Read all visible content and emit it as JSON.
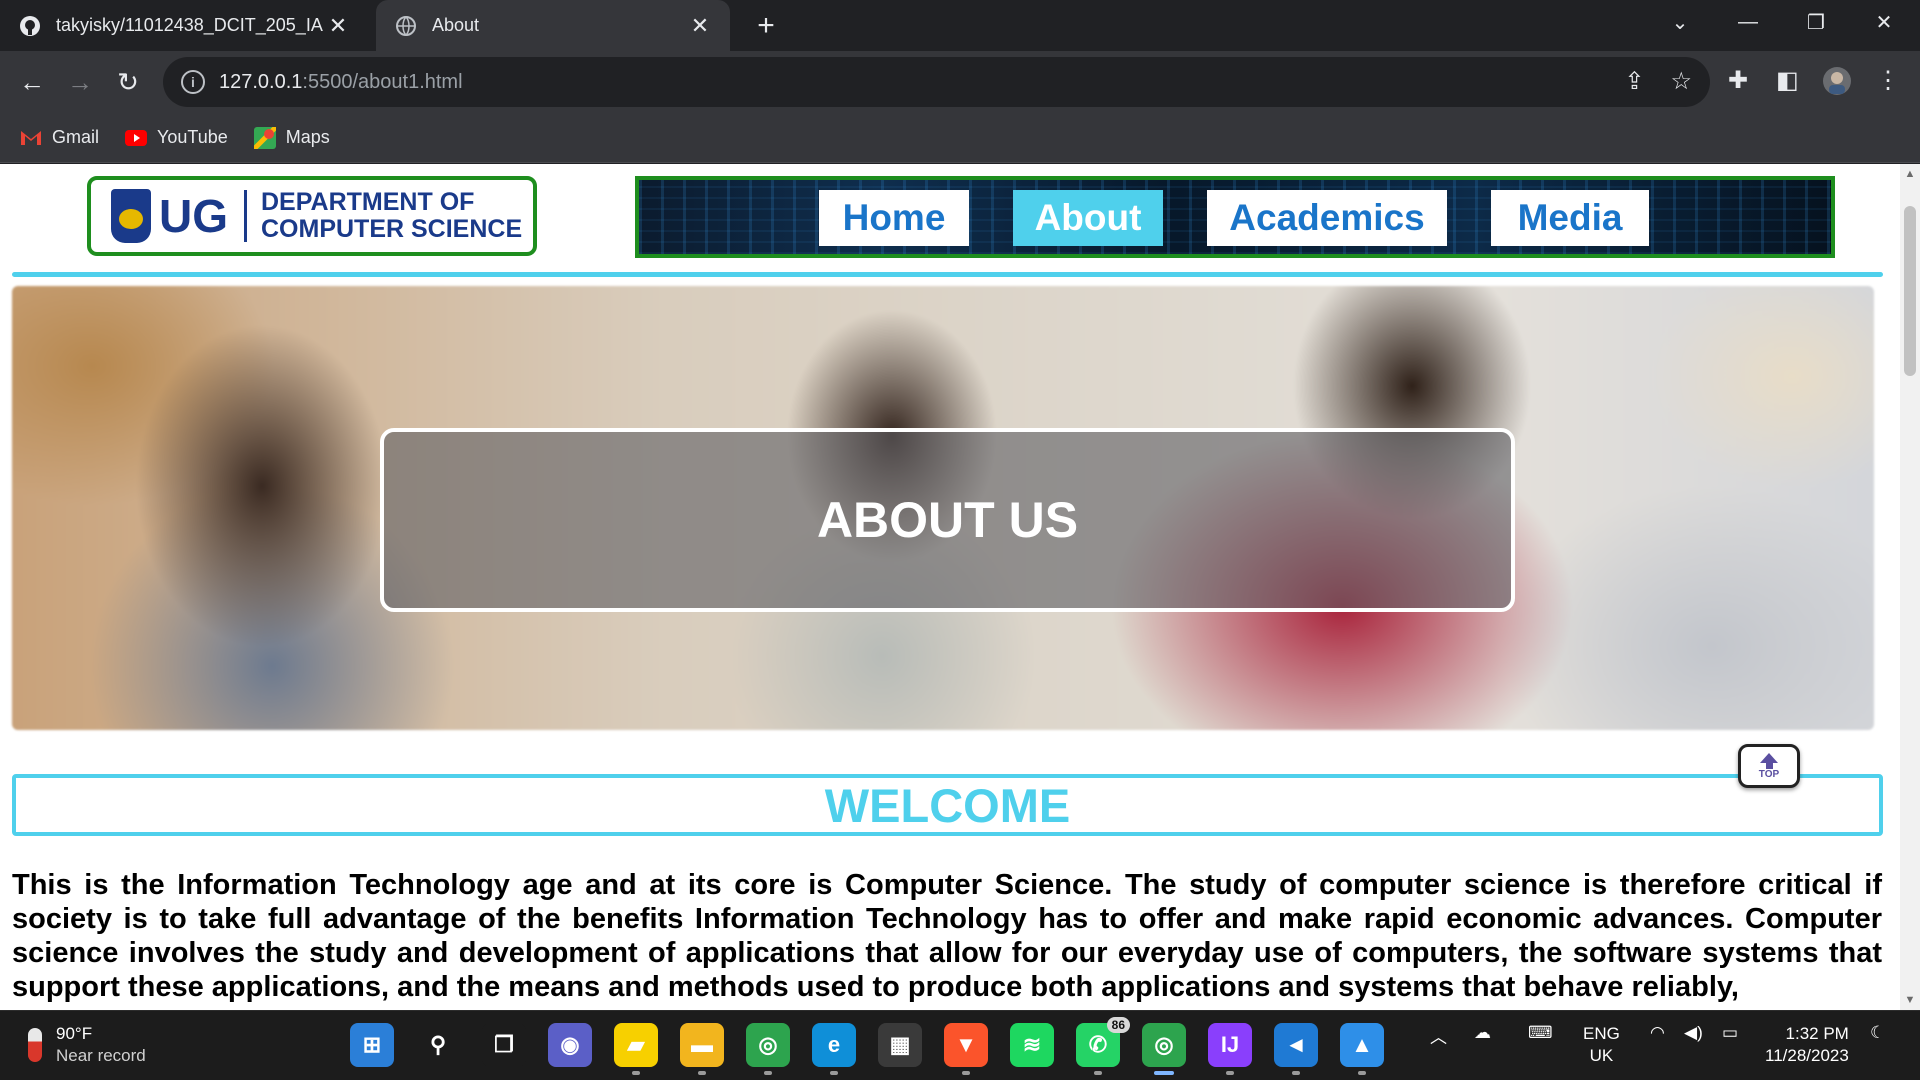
{
  "browser": {
    "tabs": [
      {
        "title": "takyisky/11012438_DCIT_205_IA",
        "icon": "github-icon",
        "active": false
      },
      {
        "title": "About",
        "icon": "globe-icon",
        "active": true
      }
    ],
    "new_tab_label": "+",
    "address": {
      "host": "127.0.0.1",
      "rest": ":5500/about1.html"
    },
    "bookmarks": [
      {
        "label": "Gmail",
        "icon": "gmail-icon",
        "color": "#ea4335"
      },
      {
        "label": "YouTube",
        "icon": "youtube-icon",
        "color": "#ff0000"
      },
      {
        "label": "Maps",
        "icon": "maps-icon",
        "color": "#34a853"
      }
    ]
  },
  "site": {
    "logo": {
      "ug": "UG",
      "dept_line1": "DEPARTMENT OF",
      "dept_line2": "COMPUTER SCIENCE"
    },
    "nav": [
      {
        "label": "Home",
        "active": false
      },
      {
        "label": "About",
        "active": true
      },
      {
        "label": "Academics",
        "active": false
      },
      {
        "label": "Media",
        "active": false
      }
    ],
    "hero_title": "ABOUT US",
    "top_button": "TOP",
    "welcome": "WELCOME",
    "intro": "This is the Information Technology age and at its core is Computer Science. The study of computer science is therefore critical if society is to take full advantage of the benefits Information Technology has to offer and make rapid economic advances. Computer science involves the study and development of applications that allow for our everyday use of computers, the software systems that support these applications, and the means and methods used to produce both applications and systems that behave reliably,",
    "colors": {
      "accent": "#4fd0ec",
      "brand": "#1a3a8a",
      "border_green": "#1e8e1e",
      "nav_text": "#1a75c9"
    }
  },
  "taskbar": {
    "weather": {
      "temp": "90°F",
      "condition": "Near record"
    },
    "apps": [
      {
        "name": "windows-start-icon",
        "glyph": "⊞",
        "color": "#2b7fd8"
      },
      {
        "name": "search-icon",
        "glyph": "⚲",
        "color": "#1c1c1c"
      },
      {
        "name": "task-view-icon",
        "glyph": "❐",
        "color": "#1c1c1c"
      },
      {
        "name": "teams-chat-icon",
        "glyph": "◉",
        "color": "#5b5fc7"
      },
      {
        "name": "sticky-notes-icon",
        "glyph": "▰",
        "color": "#f7d000"
      },
      {
        "name": "file-explorer-icon",
        "glyph": "▬",
        "color": "#f2b51e"
      },
      {
        "name": "chrome-icon",
        "glyph": "◎",
        "color": "#2da44e"
      },
      {
        "name": "edge-icon",
        "glyph": "e",
        "color": "#0f8fd8"
      },
      {
        "name": "microsoft-store-icon",
        "glyph": "▦",
        "color": "#3a3a3a"
      },
      {
        "name": "brave-icon",
        "glyph": "▼",
        "color": "#fb542b"
      },
      {
        "name": "spotify-icon",
        "glyph": "≋",
        "color": "#1ed760"
      },
      {
        "name": "whatsapp-icon",
        "glyph": "✆",
        "color": "#25d366",
        "badge": "86"
      },
      {
        "name": "chrome-profile-icon",
        "glyph": "◎",
        "color": "#2da44e"
      },
      {
        "name": "intellij-icon",
        "glyph": "IJ",
        "color": "#8a3ffc"
      },
      {
        "name": "vscode-icon",
        "glyph": "◄",
        "color": "#1f7ad4"
      },
      {
        "name": "photos-icon",
        "glyph": "▲",
        "color": "#2e8fe8"
      }
    ],
    "lang": {
      "line1": "ENG",
      "line2": "UK"
    },
    "clock": {
      "time": "1:32 PM",
      "date": "11/28/2023"
    }
  }
}
